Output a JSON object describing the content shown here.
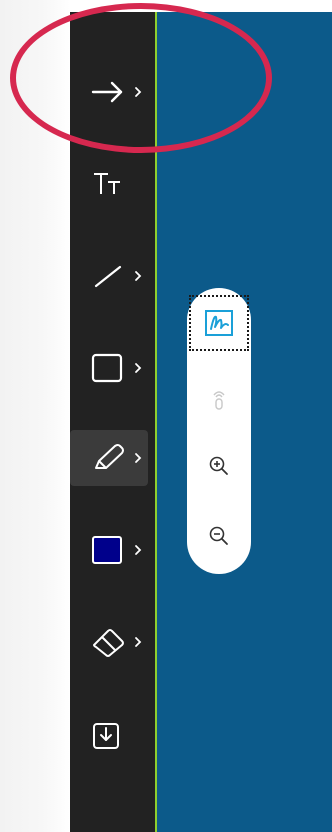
{
  "toolbar": {
    "tools": [
      {
        "name": "arrow-tool",
        "icon": "arrow-right-icon",
        "has_submenu": true
      },
      {
        "name": "text-tool",
        "icon": "text-size-icon",
        "has_submenu": false
      },
      {
        "name": "line-tool",
        "icon": "line-icon",
        "has_submenu": true
      },
      {
        "name": "rectangle-tool",
        "icon": "square-icon",
        "has_submenu": true
      },
      {
        "name": "pen-tool",
        "icon": "pencil-icon",
        "has_submenu": true,
        "active": true
      },
      {
        "name": "color-tool",
        "icon": "color-swatch-icon",
        "has_submenu": true,
        "color": "#00008b"
      },
      {
        "name": "eraser-tool",
        "icon": "eraser-icon",
        "has_submenu": true
      },
      {
        "name": "save-tool",
        "icon": "download-icon",
        "has_submenu": false
      }
    ]
  },
  "floating_panel": {
    "buttons": [
      {
        "name": "ink-mode-button",
        "icon": "signature-icon",
        "selected": true
      },
      {
        "name": "touch-button",
        "icon": "touch-icon",
        "disabled": true
      },
      {
        "name": "zoom-in-button",
        "icon": "zoom-in-icon"
      },
      {
        "name": "zoom-out-button",
        "icon": "zoom-out-icon"
      }
    ]
  },
  "colors": {
    "toolbar_bg": "#222222",
    "canvas_bg": "#0c5a8a",
    "accent_line": "#8fcf2e",
    "highlight": "#d6284f",
    "ink_accent": "#1aa0d8"
  }
}
